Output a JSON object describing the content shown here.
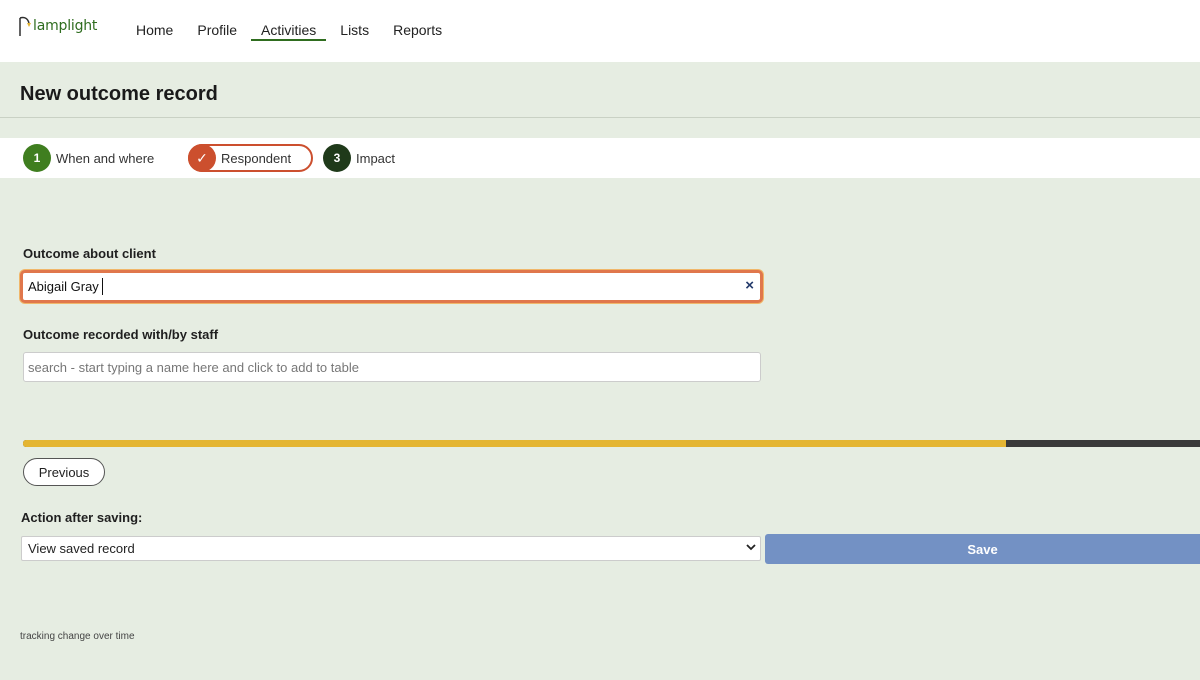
{
  "brand": {
    "name": "lamplight",
    "accent": "#2f6d1f"
  },
  "nav": {
    "items": [
      {
        "label": "Home"
      },
      {
        "label": "Profile"
      },
      {
        "label": "Activities"
      },
      {
        "label": "Lists"
      },
      {
        "label": "Reports"
      }
    ],
    "active": "Activities"
  },
  "page": {
    "title": "New outcome record"
  },
  "steps": [
    {
      "number": "1",
      "label": "When and where",
      "state": "complete",
      "color": "#3f7e1f"
    },
    {
      "number": "✓",
      "label": "Respondent",
      "state": "current",
      "color": "#cc4f2e"
    },
    {
      "number": "3",
      "label": "Impact",
      "state": "pending",
      "color": "#1f3a1a"
    }
  ],
  "form": {
    "client_label": "Outcome about client",
    "client_value": "Abigail Gray",
    "clear_icon": "×",
    "staff_label": "Outcome recorded with/by staff",
    "staff_placeholder": "search - start typing a name here and click to add to table",
    "progress_percent": 83.5,
    "previous_label": "Previous",
    "action_label": "Action after saving:",
    "action_selected": "View saved record",
    "save_label": "Save"
  },
  "footer": {
    "note": "tracking change over time"
  }
}
